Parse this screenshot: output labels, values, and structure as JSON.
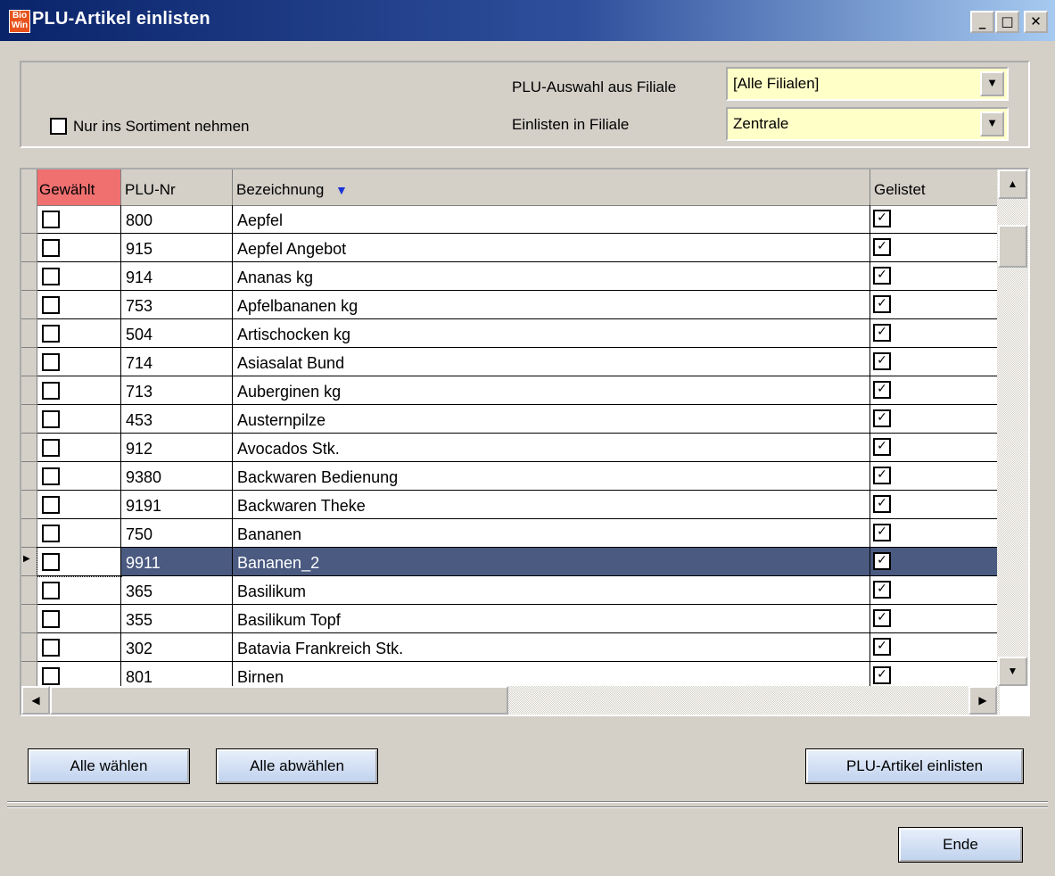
{
  "window": {
    "title": "PLU-Artikel einlisten",
    "logo_text": [
      "Bio",
      "Win"
    ],
    "minimize": "_",
    "maximize": "□",
    "close": "✕"
  },
  "filters": {
    "only_assortment_label": "Nur ins Sortiment nehmen",
    "only_assortment_checked": false,
    "plu_source_label": "PLU-Auswahl aus Filiale",
    "plu_source_value": "[Alle Filialen]",
    "target_branch_label": "Einlisten in Filiale",
    "target_branch_value": "Zentrale"
  },
  "table": {
    "columns": {
      "selected": "Gewählt",
      "plu": "PLU-Nr",
      "name": "Bezeichnung",
      "listed": "Gelistet"
    },
    "sort_indicator": "▼",
    "rows": [
      {
        "plu": "800",
        "name": "Aepfel",
        "selected": false,
        "listed": true
      },
      {
        "plu": "915",
        "name": "Aepfel Angebot",
        "selected": false,
        "listed": true
      },
      {
        "plu": "914",
        "name": "Ananas kg",
        "selected": false,
        "listed": true
      },
      {
        "plu": "753",
        "name": "Apfelbananen kg",
        "selected": false,
        "listed": true
      },
      {
        "plu": "504",
        "name": "Artischocken kg",
        "selected": false,
        "listed": true
      },
      {
        "plu": "714",
        "name": "Asiasalat  Bund",
        "selected": false,
        "listed": true
      },
      {
        "plu": "713",
        "name": "Auberginen  kg",
        "selected": false,
        "listed": true
      },
      {
        "plu": "453",
        "name": "Austernpilze",
        "selected": false,
        "listed": true
      },
      {
        "plu": "912",
        "name": "Avocados Stk.",
        "selected": false,
        "listed": true
      },
      {
        "plu": "9380",
        "name": "Backwaren Bedienung",
        "selected": false,
        "listed": true
      },
      {
        "plu": "9191",
        "name": "Backwaren Theke",
        "selected": false,
        "listed": true
      },
      {
        "plu": "750",
        "name": "Bananen",
        "selected": false,
        "listed": true
      },
      {
        "plu": "9911",
        "name": "Bananen_2",
        "selected": false,
        "listed": true
      },
      {
        "plu": "365",
        "name": "Basilikum",
        "selected": false,
        "listed": true
      },
      {
        "plu": "355",
        "name": "Basilikum Topf",
        "selected": false,
        "listed": true
      },
      {
        "plu": "302",
        "name": "Batavia Frankreich Stk.",
        "selected": false,
        "listed": true
      },
      {
        "plu": "801",
        "name": "Birnen",
        "selected": false,
        "listed": true
      }
    ],
    "current_row": 12,
    "check_glyph": "✓",
    "row_pointer": "▶"
  },
  "scroll": {
    "up": "▲",
    "down": "▼",
    "left": "◀",
    "right": "▶"
  },
  "buttons": {
    "select_all": "Alle wählen",
    "deselect_all": "Alle abwählen",
    "list_plu": "PLU-Artikel einlisten",
    "end": "Ende"
  }
}
